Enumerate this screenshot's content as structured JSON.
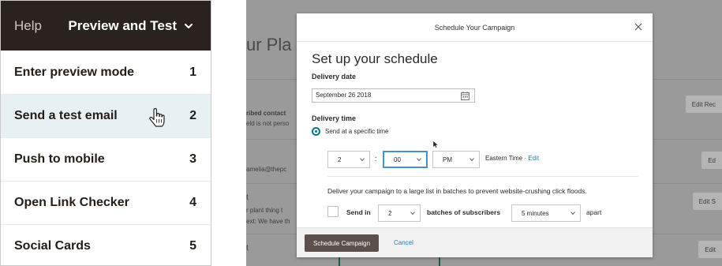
{
  "menu": {
    "help_label": "Help",
    "title": "Preview and Test",
    "items": [
      {
        "label": "Enter preview mode",
        "number": "1"
      },
      {
        "label": "Send a test email",
        "number": "2"
      },
      {
        "label": "Push to mobile",
        "number": "3"
      },
      {
        "label": "Open Link Checker",
        "number": "4"
      },
      {
        "label": "Social Cards",
        "number": "5"
      }
    ],
    "active_index": 1
  },
  "background": {
    "plan_text": "ur Pla",
    "row1_text_a": "ribed contact",
    "row1_text_b": "eld is not perso",
    "row1_button": "Edit Rec",
    "row2_text": "amelia@thepc",
    "row2_button": "Ed",
    "row3_text_a": "t",
    "row3_text_b": "r plant thing t",
    "row3_text_c": "ext: We have th",
    "row3_button": "Edit S",
    "row4_text": "t",
    "row4_button": "Edit"
  },
  "modal": {
    "header_title": "Schedule Your Campaign",
    "title": "Set up your schedule",
    "delivery_date_label": "Delivery date",
    "date_value": "September 26 2018",
    "delivery_time_label": "Delivery time",
    "radio_label": "Send at a specific time",
    "hour_value": "2",
    "minute_value": "00",
    "ampm_value": "PM",
    "timezone_text": "Eastern Time · ",
    "timezone_edit": "Edit",
    "batch_description": "Deliver your campaign to a large list in batches to prevent website-crushing click floods.",
    "send_in_label": "Send in",
    "batch_count": "2",
    "batches_label": "batches of subscribers",
    "interval_value": "5 minutes",
    "apart_label": "apart",
    "schedule_button": "Schedule Campaign",
    "cancel_button": "Cancel"
  },
  "colors": {
    "header_dark": "#2a221e",
    "active_row": "#e7f1f3",
    "accent_teal": "#00778b",
    "link_blue": "#2a7db0",
    "primary_button": "#5d4f4b"
  },
  "icons": [
    "chevron-down-icon",
    "hand-pointer-icon",
    "close-icon",
    "calendar-icon",
    "arrow-cursor-icon",
    "caret-down-icon"
  ]
}
